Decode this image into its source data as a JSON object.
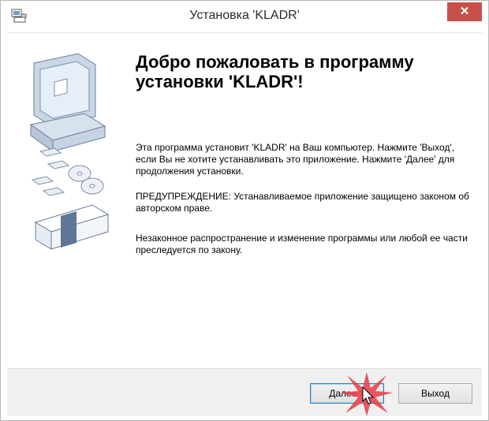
{
  "window": {
    "title": "Установка 'KLADR'",
    "close_label": "✕"
  },
  "main": {
    "welcome_title": "Добро пожаловать в программу установки 'KLADR'!",
    "paragraph1": "Эта программа установит 'KLADR' на Ваш компьютер. Нажмите 'Выход', если Вы не хотите устанавливать это приложение. Нажмите 'Далее' для продолжения установки.",
    "paragraph2": "ПРЕДУПРЕЖДЕНИЕ: Устанавливаемое приложение защищено законом об авторском праве.",
    "paragraph3": "Незаконное распространение и изменение программы или любой ее части преследуется по закону."
  },
  "buttons": {
    "next_label": "Далее >",
    "exit_label": "Выход"
  },
  "colors": {
    "close_button": "#c7504a",
    "highlight_burst": "#e8454f",
    "button_bar": "#f0f0f0"
  },
  "icons": {
    "app": "setup-icon",
    "illustration": "computer-disks-illustration",
    "cursor": "mouse-pointer-icon",
    "click": "click-highlight-icon"
  }
}
